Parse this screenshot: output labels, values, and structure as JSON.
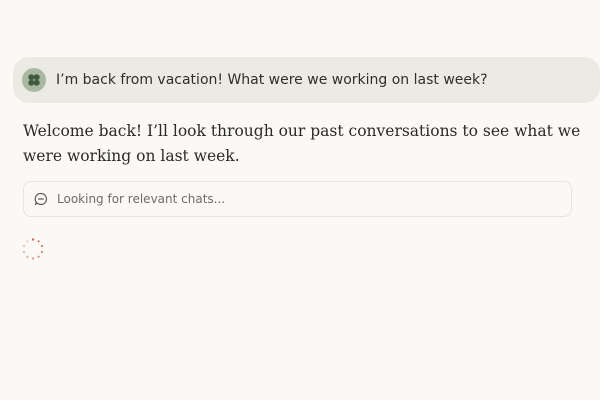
{
  "user_message": {
    "text": "I’m back from vacation! What were we working on last week?",
    "avatar_icon": "clover-icon",
    "bubble_color": "#ecebe3"
  },
  "assistant_message": {
    "text": "Welcome back! I’ll look through our past conversations to see what we were working on last week."
  },
  "tool_status": {
    "icon": "chat-bubble-icon",
    "label": "Looking for relevant chats..."
  },
  "loading_indicator": {
    "icon": "spinner-icon",
    "color": "#d9684a"
  },
  "colors": {
    "background": "#faf9f5",
    "avatar_bg": "#a9b8a3",
    "avatar_fg": "#3f5b3e"
  }
}
